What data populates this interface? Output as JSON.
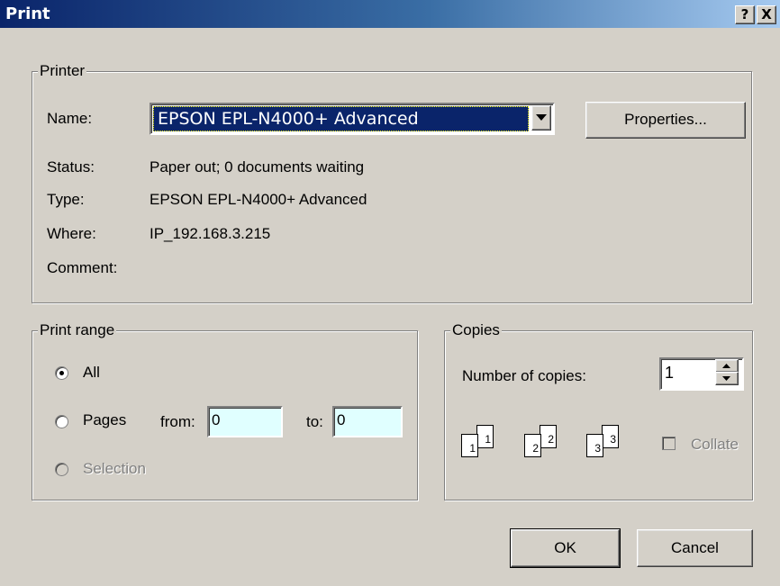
{
  "window": {
    "title": "Print",
    "help_btn": "?",
    "close_btn": "X"
  },
  "printer": {
    "legend": "Printer",
    "name_label": "Name:",
    "name_value": "EPSON EPL-N4000+ Advanced",
    "properties_label": "Properties...",
    "status_label": "Status:",
    "status_value": "Paper out; 0 documents waiting",
    "type_label": "Type:",
    "type_value": "EPSON EPL-N4000+ Advanced",
    "where_label": "Where:",
    "where_value": "IP_192.168.3.215",
    "comment_label": "Comment:",
    "comment_value": ""
  },
  "range": {
    "legend": "Print range",
    "all_label": "All",
    "pages_label": "Pages",
    "from_label": "from:",
    "from_value": "0",
    "to_label": "to:",
    "to_value": "0",
    "selection_label": "Selection",
    "selected": "All"
  },
  "copies": {
    "legend": "Copies",
    "number_label": "Number of copies:",
    "number_value": "1",
    "collate_label": "Collate",
    "collate_checked": false,
    "page_icons": [
      [
        "1",
        "1"
      ],
      [
        "2",
        "2"
      ],
      [
        "3",
        "3"
      ]
    ]
  },
  "buttons": {
    "ok": "OK",
    "cancel": "Cancel"
  },
  "colors": {
    "title_start": "#0a246a",
    "title_end": "#a6caf0",
    "face": "#d4d0c8",
    "selection": "#0a246a",
    "input_bg": "#e0ffff"
  }
}
